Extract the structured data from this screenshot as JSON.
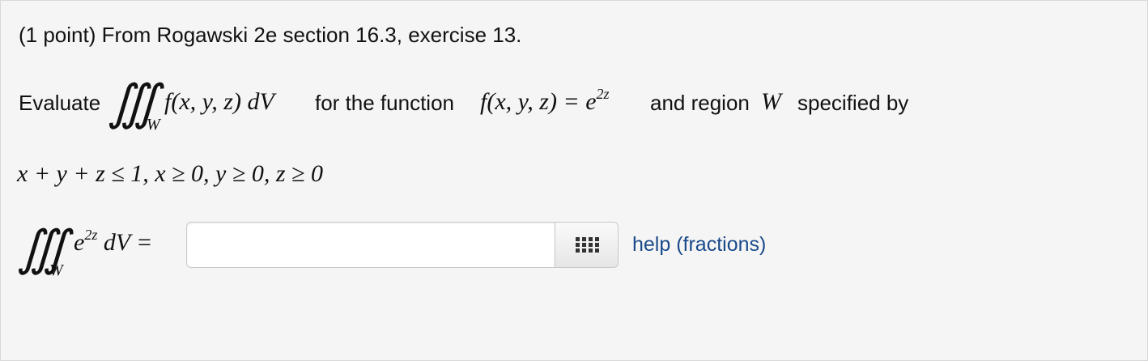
{
  "problem": {
    "header": "(1 point) From Rogawski 2e section 16.3, exercise 13.",
    "evaluate_label": "Evaluate",
    "integral_symbol": "∭",
    "integral_subscript": "W",
    "integrand": "f(x,  y,  z) dV",
    "for_the_function": "for the function",
    "function_lhs": "f(x,  y,  z) = e",
    "function_exponent": "2z",
    "and_region": "and region",
    "region_name": "W",
    "specified_by": "specified by",
    "region_inequalities": "x + y + z ≤ 1,  x ≥ 0,  y ≥ 0,  z ≥ 0"
  },
  "answer": {
    "lhs_base": "e",
    "lhs_exponent": "2z",
    "lhs_tail": "dV =",
    "input_value": "",
    "input_placeholder": ""
  },
  "help": {
    "label": "help (fractions)"
  },
  "icons": {
    "palette": "grid-icon"
  }
}
